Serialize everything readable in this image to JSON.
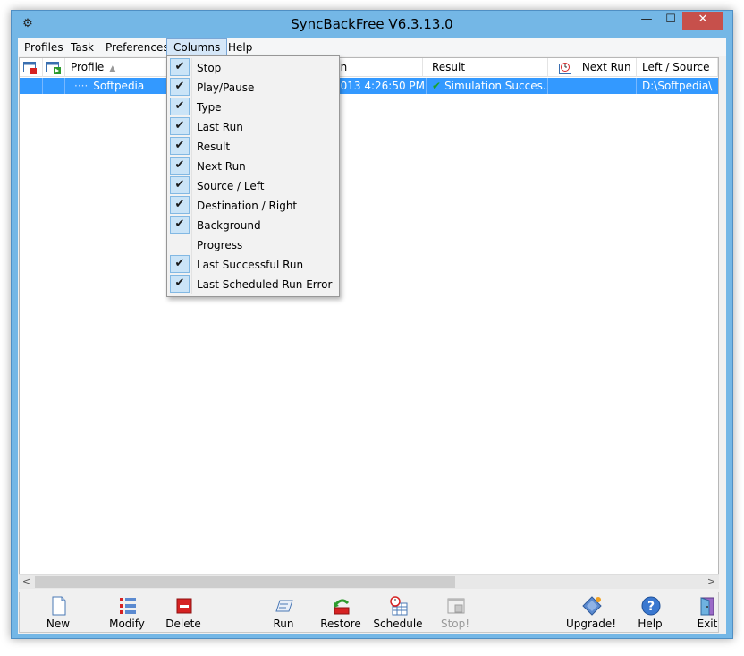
{
  "window": {
    "title": "SyncBackFree V6.3.13.0",
    "min": "—",
    "max": "☐",
    "close": "✕"
  },
  "menu": [
    "Profiles",
    "Task",
    "Preferences",
    "Columns",
    "Help"
  ],
  "columns_menu": [
    {
      "label": "Stop",
      "checked": true
    },
    {
      "label": "Play/Pause",
      "checked": true
    },
    {
      "label": "Type",
      "checked": true
    },
    {
      "label": "Last Run",
      "checked": true
    },
    {
      "label": "Result",
      "checked": true
    },
    {
      "label": "Next Run",
      "checked": true
    },
    {
      "label": "Source / Left",
      "checked": true
    },
    {
      "label": "Destination / Right",
      "checked": true
    },
    {
      "label": "Background",
      "checked": true
    },
    {
      "label": "Progress",
      "checked": false
    },
    {
      "label": "Last Successful Run",
      "checked": true
    },
    {
      "label": "Last Scheduled Run Error",
      "checked": true
    }
  ],
  "list": {
    "headers": {
      "profile": "Profile",
      "last_run": "un",
      "result": "Result",
      "next_run": "Next Run",
      "source": "Left / Source"
    },
    "rows": [
      {
        "profile": "Softpedia",
        "last_run": "2013 4:26:50 PM",
        "result": "Simulation Succes...",
        "next_run": "",
        "source": "D:\\Softpedia\\"
      }
    ]
  },
  "toolbar": {
    "new": "New",
    "modify": "Modify",
    "delete": "Delete",
    "run": "Run",
    "restore": "Restore",
    "schedule": "Schedule",
    "stop": "Stop!",
    "upgrade": "Upgrade!",
    "help": "Help",
    "exit": "Exit"
  },
  "colors": {
    "selection": "#3399ff",
    "accent": "#74b7e6",
    "check_bg": "#cbe4f7"
  }
}
